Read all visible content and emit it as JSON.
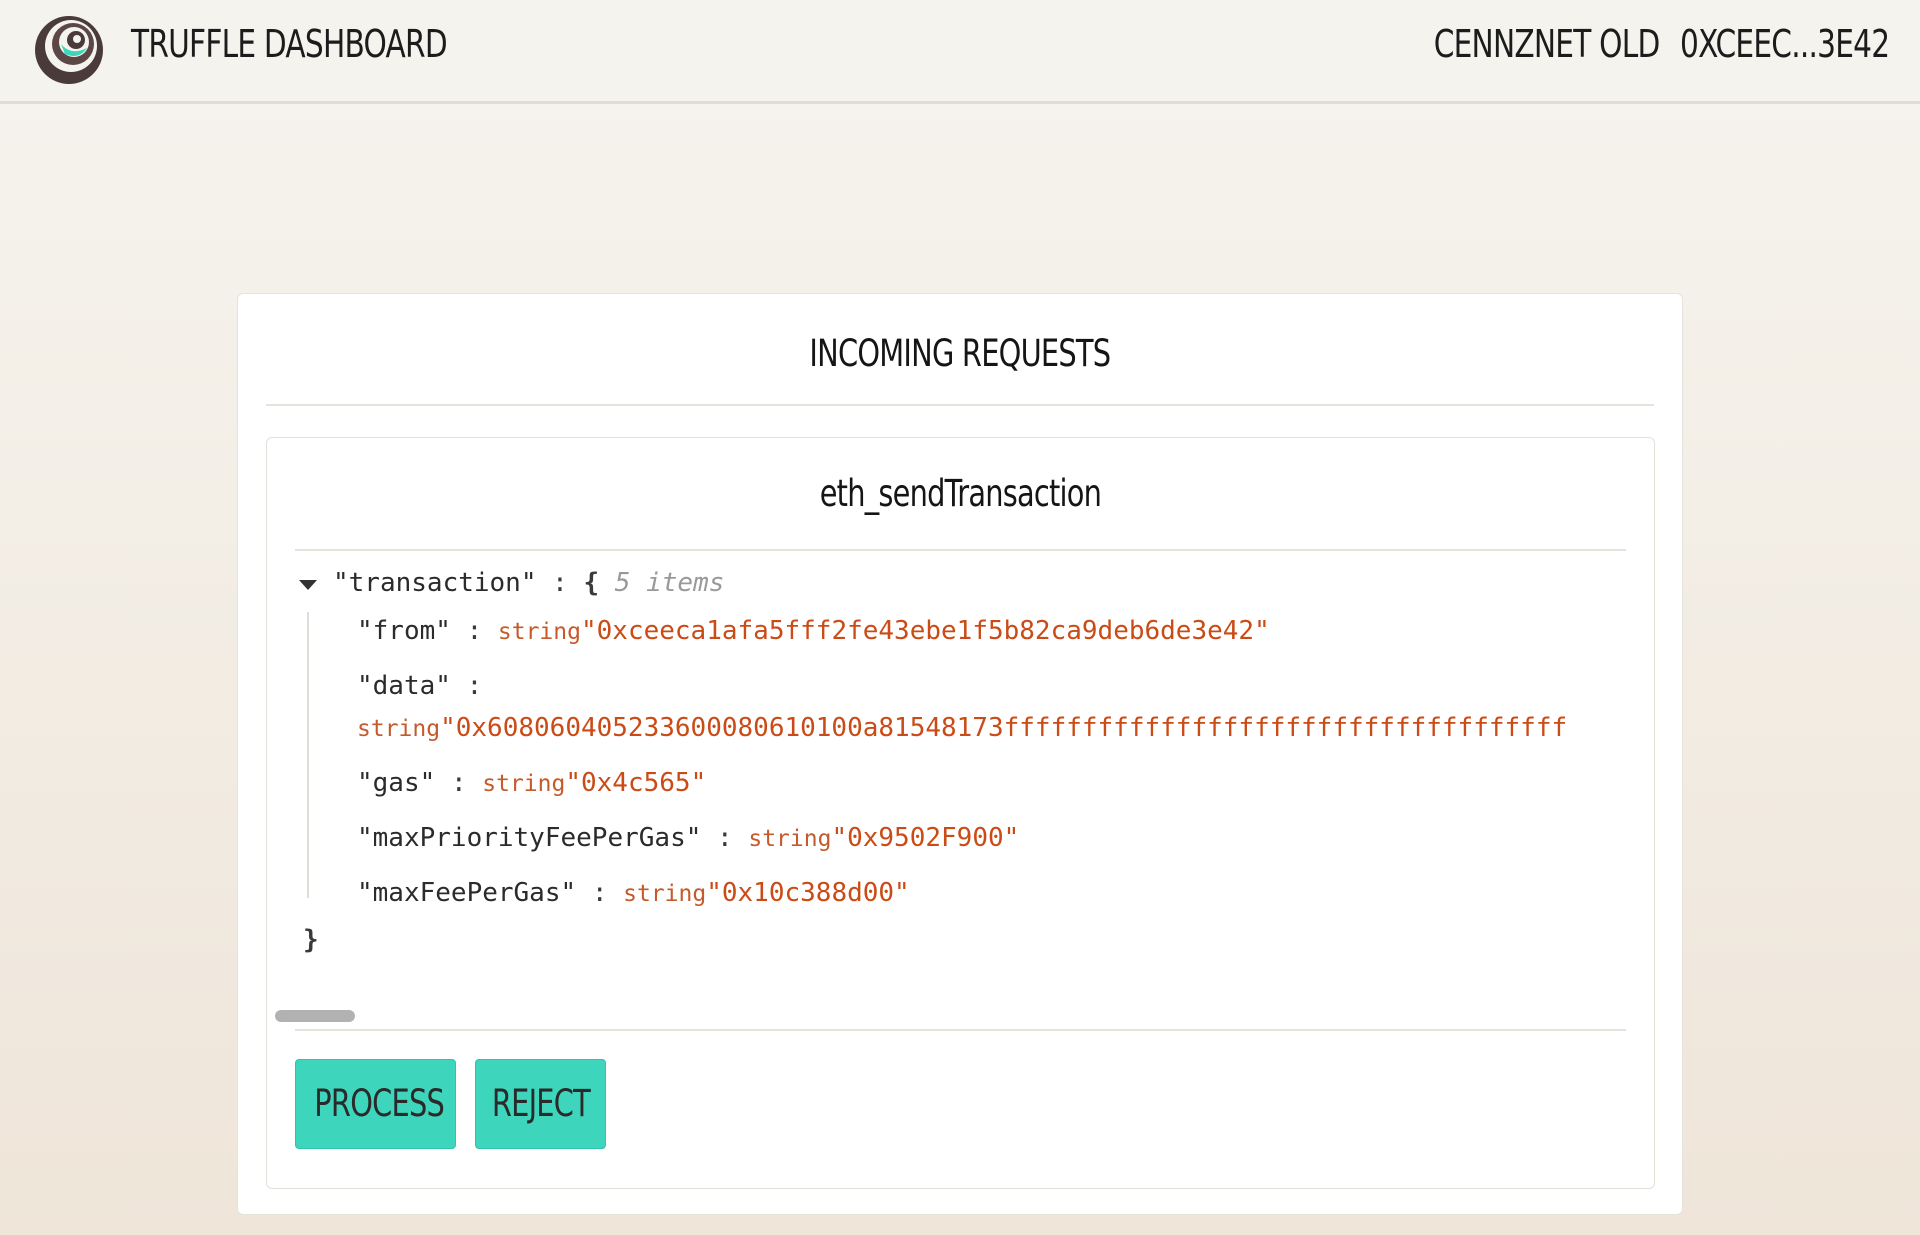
{
  "app": {
    "brand": "TRUFFLE DASHBOARD",
    "network": "CENNZNET OLD",
    "account": "0XCEEC...3E42",
    "logo_icon": "truffle-logo-icon"
  },
  "panel": {
    "title": "INCOMING REQUESTS"
  },
  "request": {
    "method": "eth_sendTransaction",
    "root_key": "\"transaction\"",
    "brace_open": "{",
    "brace_close": "}",
    "item_count": "5 items",
    "separator": ":",
    "fields": [
      {
        "key": "\"from\"",
        "type": "string",
        "value": "\"0xceeca1afa5fff2fe43ebe1f5b82ca9deb6de3e42\""
      },
      {
        "key": "\"data\"",
        "type": "string",
        "value": "\"0x608060405233600080610100a81548173ffffffffffffffffffffffffffffffffffff"
      },
      {
        "key": "\"gas\"",
        "type": "string",
        "value": "\"0x4c565\""
      },
      {
        "key": "\"maxPriorityFeePerGas\"",
        "type": "string",
        "value": "\"0x9502F900\""
      },
      {
        "key": "\"maxFeePerGas\"",
        "type": "string",
        "value": "\"0x10c388d00\""
      }
    ]
  },
  "actions": {
    "process": "PROCESS",
    "reject": "REJECT"
  },
  "colors": {
    "accent": "#3dd6bd",
    "value": "#cb4b16"
  }
}
